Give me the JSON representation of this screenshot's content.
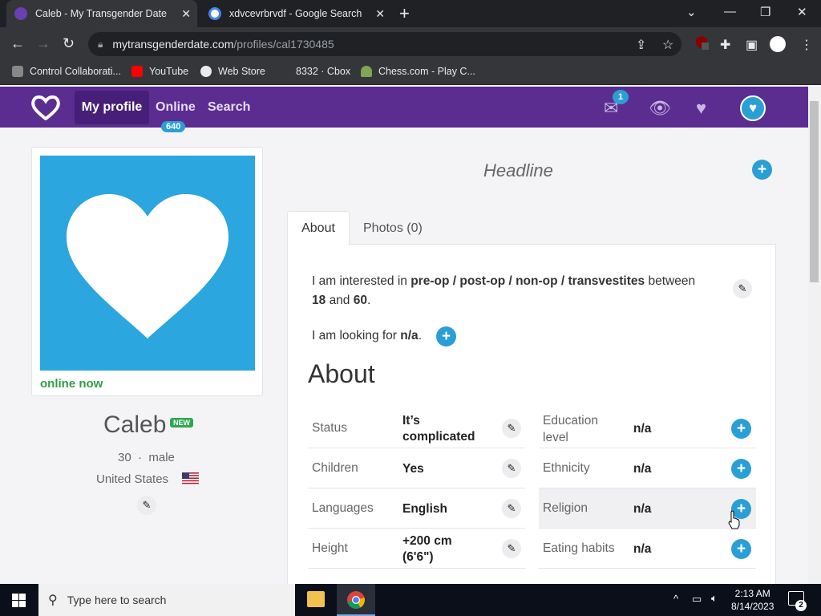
{
  "browser": {
    "tabs": [
      {
        "title": "Caleb - My Transgender Date",
        "active": true
      },
      {
        "title": "xdvcevrbrvdf - Google Search",
        "active": false
      }
    ],
    "url_domain": "mytransgenderdate.com",
    "url_path": "/profiles/cal1730485",
    "bookmarks": [
      "Control Collaborati...",
      "YouTube",
      "Web Store",
      "8332 · Cbox",
      "Chess.com - Play C..."
    ]
  },
  "site": {
    "nav": {
      "my_profile": "My profile",
      "online": "Online",
      "search": "Search"
    },
    "online_count": "640",
    "mail_count": "1",
    "brand_color": "#5b2d91",
    "accent_color": "#2a9fd6"
  },
  "profile": {
    "online_status": "online now",
    "name": "Caleb",
    "new_badge": "NEW",
    "age": "30",
    "separator": "·",
    "gender": "male",
    "country": "United States",
    "headline": "Headline"
  },
  "tabs": {
    "about": "About",
    "photos": "Photos (0)"
  },
  "interest": {
    "prefix": "I am interested in",
    "types": "pre-op / post-op / non-op / transvestites",
    "between": "between",
    "min_age": "18",
    "and": "and",
    "max_age": "60",
    "end": "."
  },
  "looking": {
    "prefix": "I am looking for",
    "value": "n/a",
    "end": "."
  },
  "about_heading": "About",
  "fields_left": [
    {
      "label": "Status",
      "value": "It’s complicated"
    },
    {
      "label": "Children",
      "value": "Yes"
    },
    {
      "label": "Languages",
      "value": "English"
    },
    {
      "label": "Height",
      "value": "+200 cm (6'6\")"
    }
  ],
  "fields_right": [
    {
      "label": "Education level",
      "value": "n/a"
    },
    {
      "label": "Ethnicity",
      "value": "n/a"
    },
    {
      "label": "Religion",
      "value": "n/a"
    },
    {
      "label": "Eating habits",
      "value": "n/a"
    }
  ],
  "taskbar": {
    "search_placeholder": "Type here to search",
    "time": "2:13 AM",
    "date": "8/14/2023",
    "notifications": "2"
  }
}
